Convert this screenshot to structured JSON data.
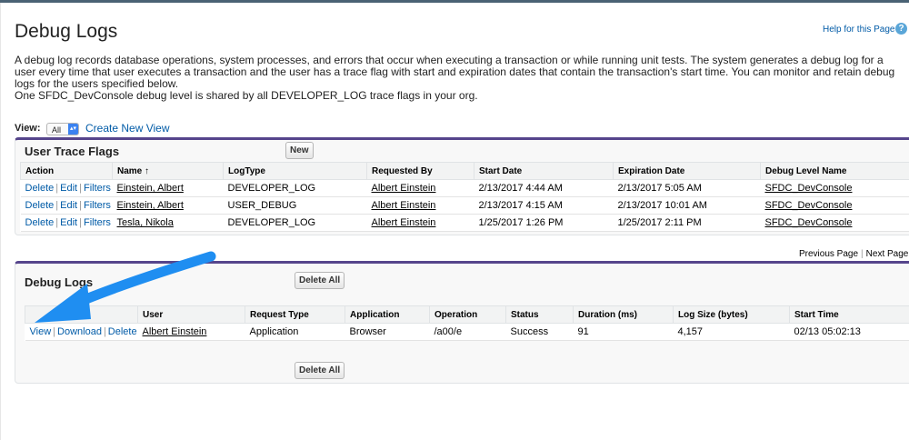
{
  "page": {
    "title": "Debug Logs",
    "help_link": "Help for this Page",
    "help_icon": "?",
    "description": [
      "A debug log records database operations, system processes, and errors that occur when executing a transaction or while running unit tests. The system generates a debug log for a user every time that user executes a transaction and the user has a trace flag with start and expiration dates that contain the transaction's start time. You can monitor and retain debug logs for the users specified below.",
      "One SFDC_DevConsole debug level is shared by all DEVELOPER_LOG trace flags in your org."
    ]
  },
  "view": {
    "label": "View:",
    "selected": "All",
    "create_link": "Create New View"
  },
  "trace_flags": {
    "title": "User Trace Flags",
    "new_button": "New",
    "columns": [
      "Action",
      "Name ↑",
      "LogType",
      "Requested By",
      "Start Date",
      "Expiration Date",
      "Debug Level Name"
    ],
    "actions": [
      "Delete",
      "Edit",
      "Filters"
    ],
    "rows": [
      {
        "name": "Einstein, Albert",
        "log_type": "DEVELOPER_LOG",
        "requested_by": "Albert Einstein",
        "start": "2/13/2017 4:44 AM",
        "expiration": "2/13/2017 5:05 AM",
        "level": "SFDC_DevConsole"
      },
      {
        "name": "Einstein, Albert",
        "log_type": "USER_DEBUG",
        "requested_by": "Albert Einstein",
        "start": "2/13/2017 4:15 AM",
        "expiration": "2/13/2017 10:01 AM",
        "level": "SFDC_DevConsole"
      },
      {
        "name": "Tesla, Nikola",
        "log_type": "DEVELOPER_LOG",
        "requested_by": "Albert Einstein",
        "start": "1/25/2017 1:26 PM",
        "expiration": "1/25/2017 2:11 PM",
        "level": "SFDC_DevConsole"
      }
    ]
  },
  "pager": {
    "previous": "Previous Page",
    "next": "Next Page"
  },
  "debug_logs": {
    "title": "Debug Logs",
    "delete_all": "Delete All",
    "columns": [
      "",
      "User",
      "Request Type",
      "Application",
      "Operation",
      "Status",
      "Duration (ms)",
      "Log Size (bytes)",
      "Start Time"
    ],
    "actions": [
      "View",
      "Download",
      "Delete"
    ],
    "rows": [
      {
        "user": "Albert Einstein",
        "request_type": "Application",
        "application": "Browser",
        "operation": "/a00/e",
        "status": "Success",
        "duration": "91",
        "log_size": "4,157",
        "start_time": "02/13 05:02:13"
      }
    ]
  },
  "colors": {
    "accent_border": "#56458c",
    "link": "#015ba7",
    "annotation_arrow": "#1f8ef1"
  }
}
